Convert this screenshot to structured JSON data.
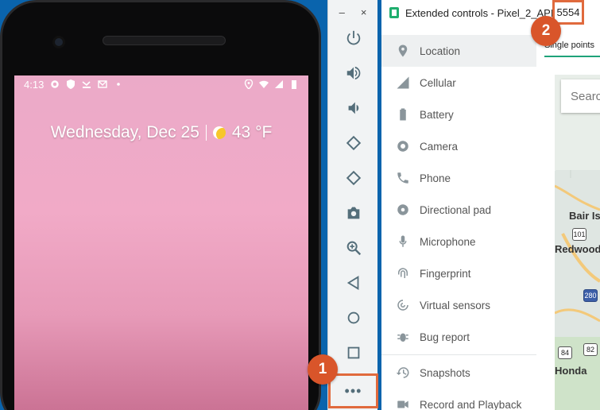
{
  "phone": {
    "status_time": "4:13",
    "date": "Wednesday, Dec 25",
    "temperature": "43 °F"
  },
  "toolbar": {
    "minimize": "–",
    "close": "×",
    "more_label": "•••"
  },
  "badges": {
    "first": "1",
    "second": "2"
  },
  "window": {
    "title": "Extended controls - Pixel_2_API_28:",
    "port": "5554",
    "tab_label": "Single points",
    "nav": [
      "Location",
      "Cellular",
      "Battery",
      "Camera",
      "Phone",
      "Directional pad",
      "Microphone",
      "Fingerprint",
      "Virtual sensors",
      "Bug report",
      "Snapshots",
      "Record and Playback"
    ]
  },
  "map": {
    "search_placeholder": "Search",
    "labels": [
      "Bair Isl",
      "Redwood",
      "Honda"
    ],
    "shields": [
      "101",
      "280",
      "84",
      "82"
    ]
  },
  "colors": {
    "accent": "#1ea37a",
    "highlight": "#e06a3d",
    "badge": "#d9552a"
  }
}
